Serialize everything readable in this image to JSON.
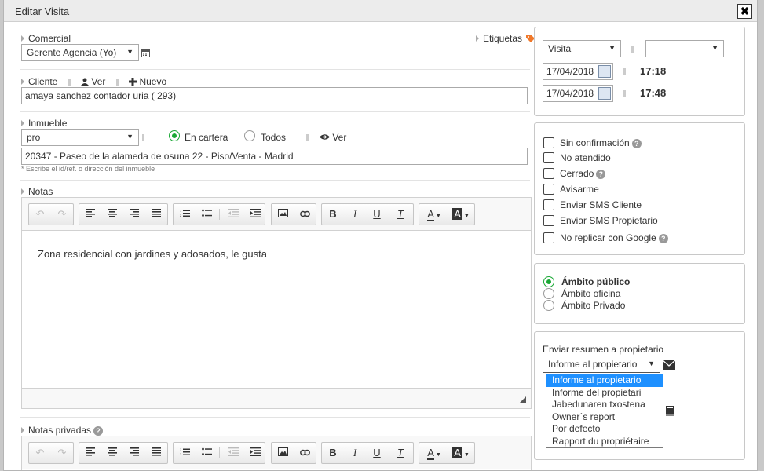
{
  "dialog": {
    "title": "Editar Visita",
    "close": "✖"
  },
  "comercial": {
    "label": "Comercial",
    "value": "Gerente Agencia (Yo)",
    "etiquetas": "Etiquetas"
  },
  "cliente": {
    "label": "Cliente",
    "ver": "Ver",
    "nuevo": "Nuevo",
    "value": "amaya sanchez contador uria ( 293)"
  },
  "inmueble": {
    "label": "Inmueble",
    "select_value": "pro",
    "radio_cartera": "En cartera",
    "radio_todos": "Todos",
    "ver": "Ver",
    "value": "20347 - Paseo de la alameda de osuna 22 - Piso/Venta - Madrid",
    "hint": "* Escribe el id/ref. o dirección del inmueble"
  },
  "notas": {
    "label": "Notas",
    "text": "Zona residencial con jardines y adosados, le gusta"
  },
  "notas_privadas": {
    "label": "Notas privadas"
  },
  "toolbar": {
    "undo": "↶",
    "redo": "↷",
    "bold": "B",
    "italic": "I",
    "underline": "U",
    "clear_format": "T",
    "font_color": "A",
    "bg_color": "A"
  },
  "schedule": {
    "type_value": "Visita",
    "second_value": "",
    "date_start": "17/04/2018",
    "time_start": "17:18",
    "date_end": "17/04/2018",
    "time_end": "17:48"
  },
  "options": [
    {
      "label": "Sin confirmación",
      "help": true
    },
    {
      "label": "No atendido",
      "help": false
    },
    {
      "label": "Cerrado",
      "help": true
    },
    {
      "label": "Avisarme",
      "help": false
    },
    {
      "label": "Enviar SMS Cliente",
      "help": false
    },
    {
      "label": "Enviar SMS Propietario",
      "help": false
    },
    {
      "label": "No replicar con Google",
      "help": true
    }
  ],
  "ambito": {
    "publico": "Ámbito público",
    "oficina": "Ámbito oficina",
    "privado": "Ámbito Privado",
    "selected": "publico"
  },
  "resumen": {
    "label": "Enviar resumen a propietario",
    "select_value": "Informe al propietario",
    "dropdown_options": [
      "Informe al propietario",
      "Informe del propietari",
      "Jabedunaren txostena",
      "Owner´s report",
      "Por defecto",
      "Rapport du propriétaire"
    ]
  },
  "colors": {
    "accent_green": "#1aa835",
    "tag_orange": "#f0782a",
    "selection_blue": "#1e90ff"
  }
}
